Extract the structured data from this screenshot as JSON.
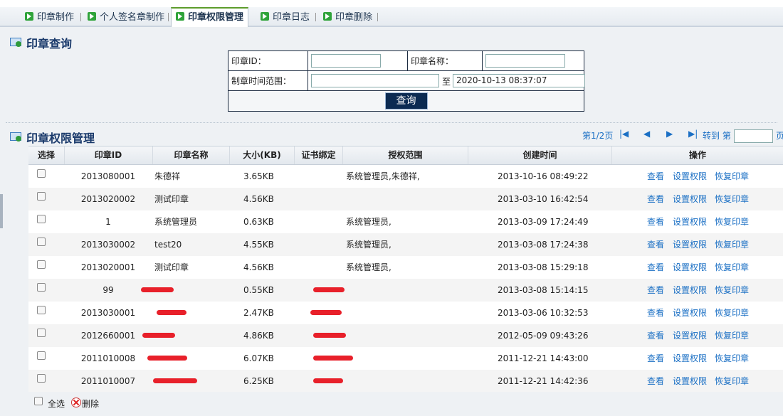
{
  "tabs": [
    {
      "label": "印章制作",
      "active": false
    },
    {
      "label": "个人签名章制作",
      "active": false
    },
    {
      "label": "印章权限管理",
      "active": true
    },
    {
      "label": "印章日志",
      "active": false
    },
    {
      "label": "印章删除",
      "active": false
    }
  ],
  "query": {
    "title": "印章查询",
    "id_label": "印章ID：",
    "name_label": "印章名称：",
    "time_label": "制章时间范围：",
    "to_label": "至",
    "end_time_value": "2020-10-13 08:37:07",
    "search_button": "查询"
  },
  "manage": {
    "title": "印章权限管理",
    "pager": {
      "page_text": "第1/2页",
      "goto_text": "转到 第",
      "unit_text": "页"
    },
    "columns": [
      "选择",
      "印章ID",
      "印章名称",
      "大小(KB)",
      "证书绑定",
      "授权范围",
      "创建时间",
      "操作"
    ],
    "actions": [
      "查看",
      "设置权限",
      "恢复印章"
    ],
    "rows": [
      {
        "id": "2013080001",
        "name": "朱德祥",
        "size": "3.65KB",
        "cert": "",
        "scope": "系统管理员,朱德祥,",
        "time": "2013-10-16 08:49:22"
      },
      {
        "id": "2013020002",
        "name": "测试印章",
        "size": "4.56KB",
        "cert": "",
        "scope": "",
        "time": "2013-03-10 16:42:54"
      },
      {
        "id": "1",
        "name": "系统管理员",
        "size": "0.63KB",
        "cert": "",
        "scope": "系统管理员,",
        "time": "2013-03-09 17:24:49"
      },
      {
        "id": "2013030002",
        "name": "test20",
        "size": "4.55KB",
        "cert": "",
        "scope": "系统管理员,",
        "time": "2013-03-08 17:24:38"
      },
      {
        "id": "2013020001",
        "name": "测试印章",
        "size": "4.56KB",
        "cert": "",
        "scope": "系统管理员,",
        "time": "2013-03-08 15:29:18"
      },
      {
        "id": "99",
        "name": "",
        "size": "0.55KB",
        "cert": "",
        "scope": "",
        "time": "2013-03-08 15:14:15"
      },
      {
        "id": "2013030001",
        "name": "",
        "size": "2.47KB",
        "cert": "",
        "scope": "",
        "time": "2013-03-06 10:32:53"
      },
      {
        "id": "2012660001",
        "name": "",
        "size": "4.86KB",
        "cert": "",
        "scope": "",
        "time": "2012-05-09 09:43:26"
      },
      {
        "id": "2011010008",
        "name": "",
        "size": "6.07KB",
        "cert": "",
        "scope": "",
        "time": "2011-12-21 14:43:00"
      },
      {
        "id": "2011010007",
        "name": "",
        "size": "6.25KB",
        "cert": "",
        "scope": "",
        "time": "2011-12-21 14:42:36"
      }
    ]
  },
  "footer": {
    "select_all": "全选",
    "delete": "删除"
  },
  "colors": {
    "title": "#1a3a6b",
    "link": "#1a6fc4",
    "redact": "#e8202a",
    "button_bg": "#0c2b52"
  }
}
